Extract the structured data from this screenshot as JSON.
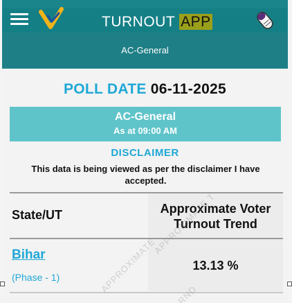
{
  "header": {
    "title_main": "TURNOUT",
    "title_accent": "APP",
    "menu_icon": "hamburger-menu-icon",
    "logo_icon": "voter-turnout-logo-icon",
    "finger_icon": "inked-finger-icon"
  },
  "subheader": {
    "label": "AC-General"
  },
  "poll": {
    "label": "POLL DATE",
    "value": "06-11-2025"
  },
  "banner": {
    "line1": "AC-General",
    "line2": "As at 09:00 AM"
  },
  "disclaimer": {
    "heading": "DISCLAIMER",
    "text": "This data is being viewed as per the disclaimer I have accepted."
  },
  "table": {
    "headers": {
      "state": "State/UT",
      "trend": "Approximate Voter Turnout Trend"
    },
    "rows": [
      {
        "state": "Bihar",
        "phase": "(Phase - 1)",
        "value": "13.13 %"
      }
    ]
  },
  "watermark": {
    "text1": "APPROXIMATE T",
    "text2": "APPROXIMATE",
    "text3": "RND"
  },
  "colors": {
    "topbar": "#157f86",
    "subbar": "#1e7f86",
    "accent_blue": "#1fa8d6",
    "banner": "#5fc4c9",
    "app_highlight": "#9aa01a"
  }
}
